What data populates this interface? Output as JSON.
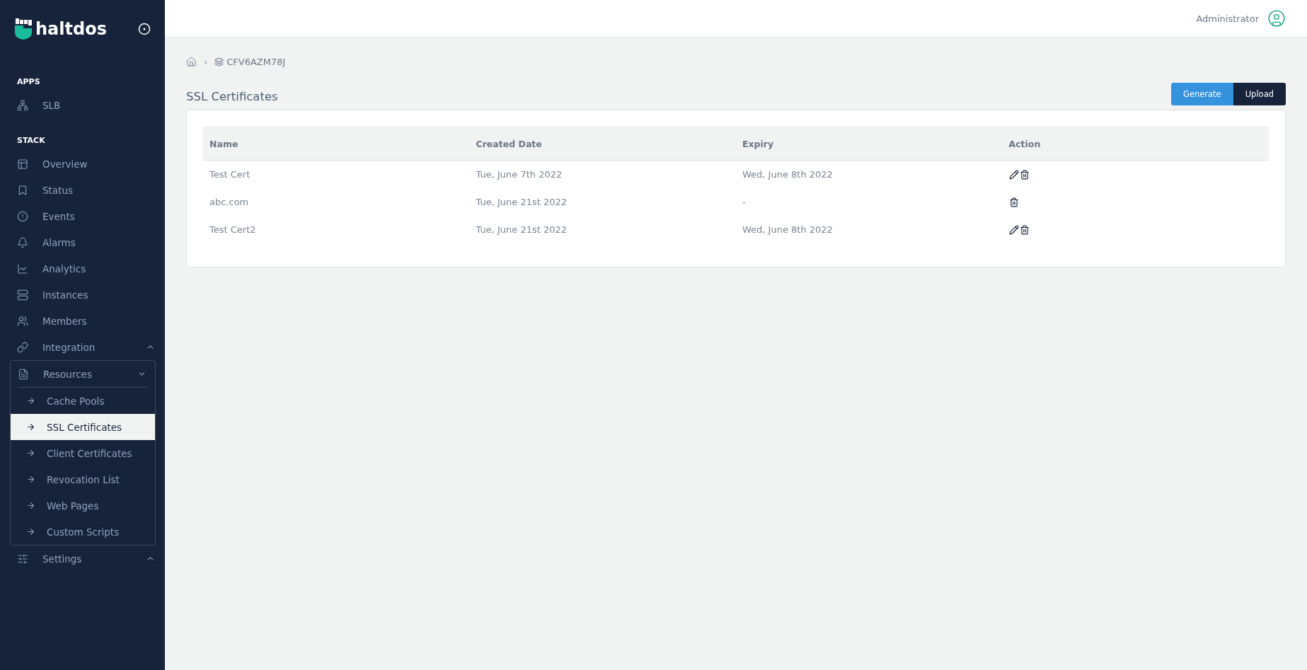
{
  "brand": {
    "name": "haltdos"
  },
  "sidebar": {
    "sections": [
      {
        "title": "APPS",
        "items": [
          {
            "kind": "link",
            "label": "SLB"
          }
        ]
      },
      {
        "title": "STACK",
        "items": [
          {
            "kind": "link",
            "label": "Overview"
          },
          {
            "kind": "link",
            "label": "Status"
          },
          {
            "kind": "link",
            "label": "Events"
          },
          {
            "kind": "link",
            "label": "Alarms"
          },
          {
            "kind": "link",
            "label": "Analytics"
          },
          {
            "kind": "link",
            "label": "Instances"
          },
          {
            "kind": "link",
            "label": "Members"
          },
          {
            "kind": "group",
            "label": "Integration",
            "expanded": false
          },
          {
            "kind": "group",
            "label": "Resources",
            "expanded": true,
            "children": [
              {
                "label": "Cache Pools",
                "selected": false
              },
              {
                "label": "SSL Certificates",
                "selected": true
              },
              {
                "label": "Client Certificates",
                "selected": false
              },
              {
                "label": "Revocation List",
                "selected": false
              },
              {
                "label": "Web Pages",
                "selected": false
              },
              {
                "label": "Custom Scripts",
                "selected": false
              }
            ]
          },
          {
            "kind": "group",
            "label": "Settings",
            "expanded": false
          }
        ]
      }
    ]
  },
  "header": {
    "user": "Administrator"
  },
  "breadcrumb": {
    "separator": "›",
    "current": "CFV6AZM78J"
  },
  "page": {
    "title": "SSL Certificates",
    "buttons": [
      {
        "label": "Generate",
        "kind": "primary"
      },
      {
        "label": "Upload",
        "kind": "dark"
      }
    ]
  },
  "table": {
    "columns": [
      "Name",
      "Created Date",
      "Expiry",
      "Action"
    ],
    "rows": [
      {
        "name": "Test Cert",
        "created": "Tue, June 7th 2022",
        "expiry": "Wed, June 8th 2022",
        "editable": true,
        "deletable": true
      },
      {
        "name": "abc.com",
        "created": "Tue, June 21st 2022",
        "expiry": "-",
        "editable": false,
        "deletable": true
      },
      {
        "name": "Test Cert2",
        "created": "Tue, June 21st 2022",
        "expiry": "Wed, June 8th 2022",
        "editable": true,
        "deletable": true
      }
    ]
  }
}
